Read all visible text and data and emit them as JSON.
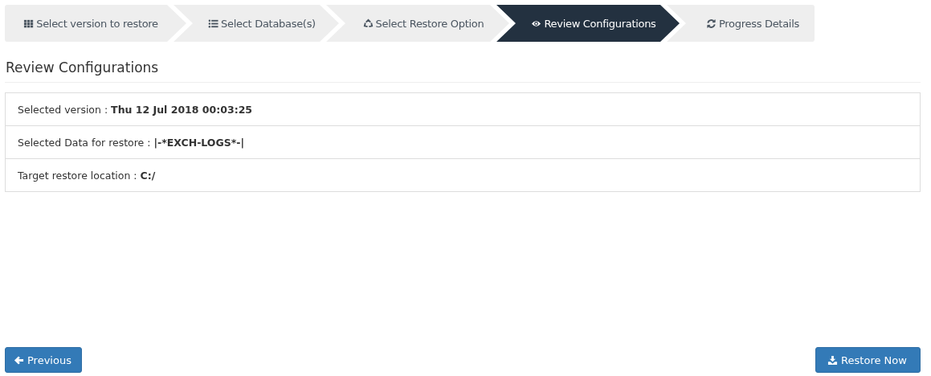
{
  "steps": [
    {
      "label": "Select version to restore",
      "selected": false
    },
    {
      "label": "Select Database(s)",
      "selected": false
    },
    {
      "label": "Select Restore Option",
      "selected": false
    },
    {
      "label": "Review Configurations",
      "selected": true
    },
    {
      "label": "Progress Details",
      "selected": false
    }
  ],
  "heading": "Review Configurations",
  "details": [
    {
      "label": "Selected version : ",
      "value": "Thu 12 Jul 2018 00:03:25"
    },
    {
      "label": "Selected Data for restore : ",
      "value": "|-*EXCH-LOGS*-|"
    },
    {
      "label": "Target restore location : ",
      "value": "C:/"
    }
  ],
  "buttons": [
    {
      "label": "Previous"
    },
    {
      "label": "Restore Now"
    }
  ]
}
